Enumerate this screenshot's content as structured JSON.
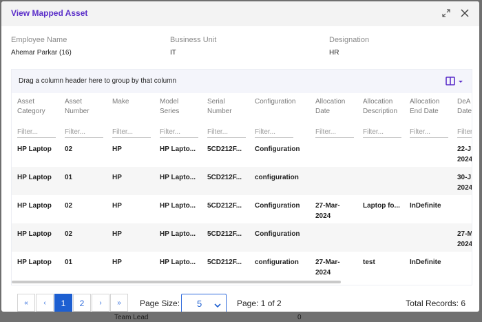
{
  "background": {
    "text_left": "Team Lead",
    "text_right": "0"
  },
  "modal": {
    "title": "View Mapped Asset"
  },
  "info": [
    {
      "label": "Employee Name",
      "value": "Ahemar Parkar (16)"
    },
    {
      "label": "Business Unit",
      "value": "IT"
    },
    {
      "label": "Designation",
      "value": "HR"
    }
  ],
  "grid": {
    "group_hint": "Drag a column header here to group by that column",
    "filter_placeholder": "Filter...",
    "columns": [
      {
        "line1": "Asset",
        "line2": "Category"
      },
      {
        "line1": "Asset",
        "line2": "Number"
      },
      {
        "line1": "Make",
        "line2": ""
      },
      {
        "line1": "Model",
        "line2": "Series"
      },
      {
        "line1": "Serial",
        "line2": "Number"
      },
      {
        "line1": "Configuration",
        "line2": ""
      },
      {
        "line1": "Allocation",
        "line2": "Date"
      },
      {
        "line1": "Allocation",
        "line2": "Description"
      },
      {
        "line1": "Allocation",
        "line2": "End Date"
      },
      {
        "line1": "DeA",
        "line2": "Date"
      }
    ],
    "rows": [
      [
        "HP Laptop",
        "02",
        "HP",
        "HP Lapto...",
        "5CD212F...",
        "Configuration",
        [
          "",
          ""
        ],
        "",
        "",
        [
          "22-J",
          "2024"
        ]
      ],
      [
        "HP Laptop",
        "01",
        "HP",
        "HP Lapto...",
        "5CD212F...",
        "configuration",
        [
          "",
          ""
        ],
        "",
        "",
        [
          "30-J",
          "2024"
        ]
      ],
      [
        "HP Laptop",
        "02",
        "HP",
        "HP Lapto...",
        "5CD212F...",
        "Configuration",
        [
          "27-Mar-",
          "2024"
        ],
        "Laptop fo...",
        "InDefinite",
        [
          "",
          ""
        ]
      ],
      [
        "HP Laptop",
        "02",
        "HP",
        "HP Lapto...",
        "5CD212F...",
        "Configuration",
        [
          "",
          ""
        ],
        "",
        "",
        [
          "27-M",
          "2024"
        ]
      ],
      [
        "HP Laptop",
        "01",
        "HP",
        "HP Lapto...",
        "5CD212F...",
        "configuration",
        [
          "27-Mar-",
          "2024"
        ],
        "test",
        "InDefinite",
        [
          "",
          ""
        ]
      ]
    ]
  },
  "pager": {
    "first": "«",
    "prev": "‹",
    "pages": [
      "1",
      "2"
    ],
    "next": "›",
    "last": "»",
    "page_size_label": "Page Size:",
    "page_size": "5",
    "page_info": "Page: 1 of 2",
    "total": "Total Records: 6"
  },
  "icons": [
    "expand-icon",
    "close-icon",
    "column-chooser-icon",
    "chevron-down-icon"
  ],
  "colors": {
    "title": "#5b2fc9",
    "accent": "#1d5fd1"
  }
}
